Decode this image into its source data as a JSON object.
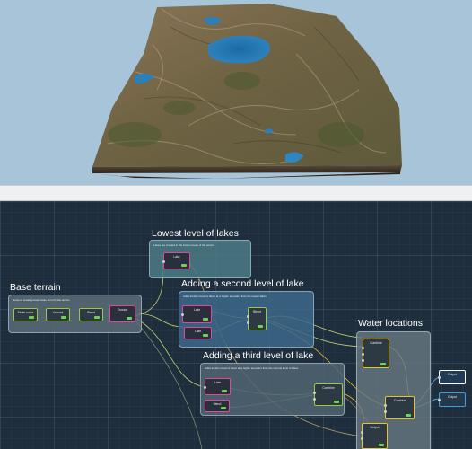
{
  "viewport": {
    "sky_color": "#a7c4d8"
  },
  "graph": {
    "groups": [
      {
        "id": "base-terrain",
        "title": "Base terrain",
        "description": "Noise to create a basic base form for the terrain",
        "color": "#5b6c78"
      },
      {
        "id": "lowest-lakes",
        "title": "Lowest level of lakes",
        "description": "Lakes are created in the lowest areas of the terrain",
        "color": "#4b7a86"
      },
      {
        "id": "second-lake",
        "title": "Adding a second level of lake",
        "description": "Adds another level of lakes at a higher elevation than the lowest lakes",
        "color": "#3c6888"
      },
      {
        "id": "third-lake",
        "title": "Adding a third level of lake",
        "description": "Adds another level of lakes at a higher elevation than the second level of lakes",
        "color": "#50636f"
      },
      {
        "id": "water-locations",
        "title": "Water locations",
        "description": "",
        "color": "#687780"
      }
    ],
    "nodes": [
      {
        "id": "n1",
        "label": "Perlin noise"
      },
      {
        "id": "n2",
        "label": "Voronoi"
      },
      {
        "id": "n3",
        "label": "Blend"
      },
      {
        "id": "n4",
        "label": "Erosion"
      },
      {
        "id": "n5",
        "label": "Lake"
      },
      {
        "id": "n6",
        "label": "Lake"
      },
      {
        "id": "n7",
        "label": "Lake"
      },
      {
        "id": "n8",
        "label": "Blend"
      },
      {
        "id": "n9",
        "label": "Lake"
      },
      {
        "id": "n10",
        "label": "Blend"
      },
      {
        "id": "n11",
        "label": "Combine"
      },
      {
        "id": "n12",
        "label": "Combine"
      },
      {
        "id": "n13",
        "label": "Combine"
      },
      {
        "id": "n14",
        "label": "Output"
      },
      {
        "id": "n15",
        "label": "Output"
      }
    ]
  }
}
